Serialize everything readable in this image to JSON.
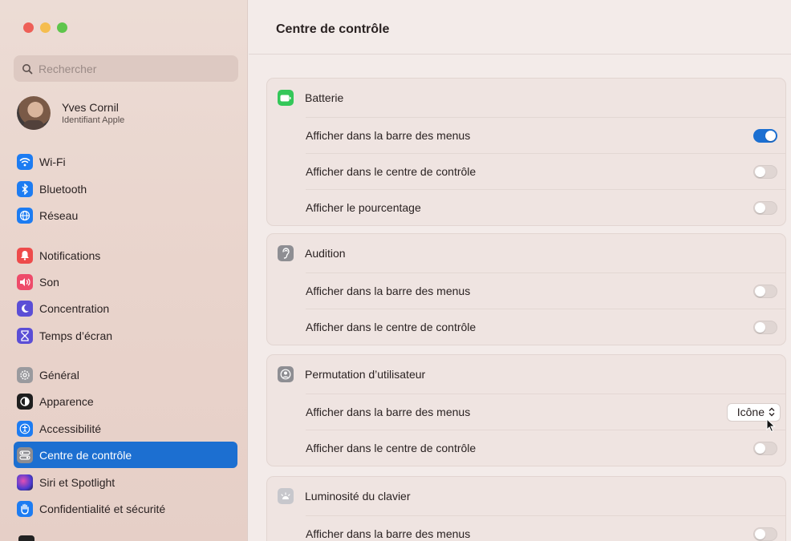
{
  "window": {
    "title": "Centre de contrôle"
  },
  "sidebar": {
    "search_placeholder": "Rechercher",
    "user": {
      "name": "Yves Cornil",
      "subtitle": "Identifiant Apple"
    },
    "items": [
      {
        "label": "Wi-Fi",
        "icon": "wifi-icon",
        "color": "#1d7cf2"
      },
      {
        "label": "Bluetooth",
        "icon": "bluetooth-icon",
        "color": "#1d7cf2"
      },
      {
        "label": "Réseau",
        "icon": "globe-icon",
        "color": "#1d7cf2"
      },
      {
        "label": "Notifications",
        "icon": "bell-icon",
        "color": "#ee4b4b"
      },
      {
        "label": "Son",
        "icon": "speaker-icon",
        "color": "#ee4b6a"
      },
      {
        "label": "Concentration",
        "icon": "moon-icon",
        "color": "#5b4ed6"
      },
      {
        "label": "Temps d’écran",
        "icon": "hourglass-icon",
        "color": "#5b4ed6"
      },
      {
        "label": "Général",
        "icon": "gear-icon",
        "color": "#9a9a9e"
      },
      {
        "label": "Apparence",
        "icon": "appearance-icon",
        "color": "#1e1e1e"
      },
      {
        "label": "Accessibilité",
        "icon": "accessibility-icon",
        "color": "#1d7cf2"
      },
      {
        "label": "Centre de contrôle",
        "icon": "control-center-icon",
        "color": "#8d8d92",
        "active": true
      },
      {
        "label": "Siri et Spotlight",
        "icon": "siri-icon",
        "color": "#5a3fd1"
      },
      {
        "label": "Confidentialité et sécurité",
        "icon": "hand-icon",
        "color": "#1d7cf2"
      }
    ]
  },
  "main": {
    "ghost_row": "Afficher dans le centre de contrôle",
    "sections": [
      {
        "title": "Batterie",
        "icon": "battery-icon",
        "color": "#34c759",
        "rows": [
          {
            "label": "Afficher dans la barre des menus",
            "control": "toggle",
            "on": true
          },
          {
            "label": "Afficher dans le centre de contrôle",
            "control": "toggle",
            "on": false
          },
          {
            "label": "Afficher le pourcentage",
            "control": "toggle",
            "on": false
          }
        ]
      },
      {
        "title": "Audition",
        "icon": "ear-icon",
        "color": "#8e8e93",
        "rows": [
          {
            "label": "Afficher dans la barre des menus",
            "control": "toggle",
            "on": false
          },
          {
            "label": "Afficher dans le centre de contrôle",
            "control": "toggle",
            "on": false
          }
        ]
      },
      {
        "title": "Permutation d’utilisateur",
        "icon": "user-switch-icon",
        "color": "#8e8e93",
        "rows": [
          {
            "label": "Afficher dans la barre des menus",
            "control": "select",
            "value": "Icône"
          },
          {
            "label": "Afficher dans le centre de contrôle",
            "control": "toggle",
            "on": false
          }
        ]
      },
      {
        "title": "Luminosité du clavier",
        "icon": "keyboard-brightness-icon",
        "color": "#c7c7cc",
        "rows": [
          {
            "label": "Afficher dans la barre des menus",
            "control": "toggle",
            "on": false
          }
        ]
      }
    ]
  }
}
